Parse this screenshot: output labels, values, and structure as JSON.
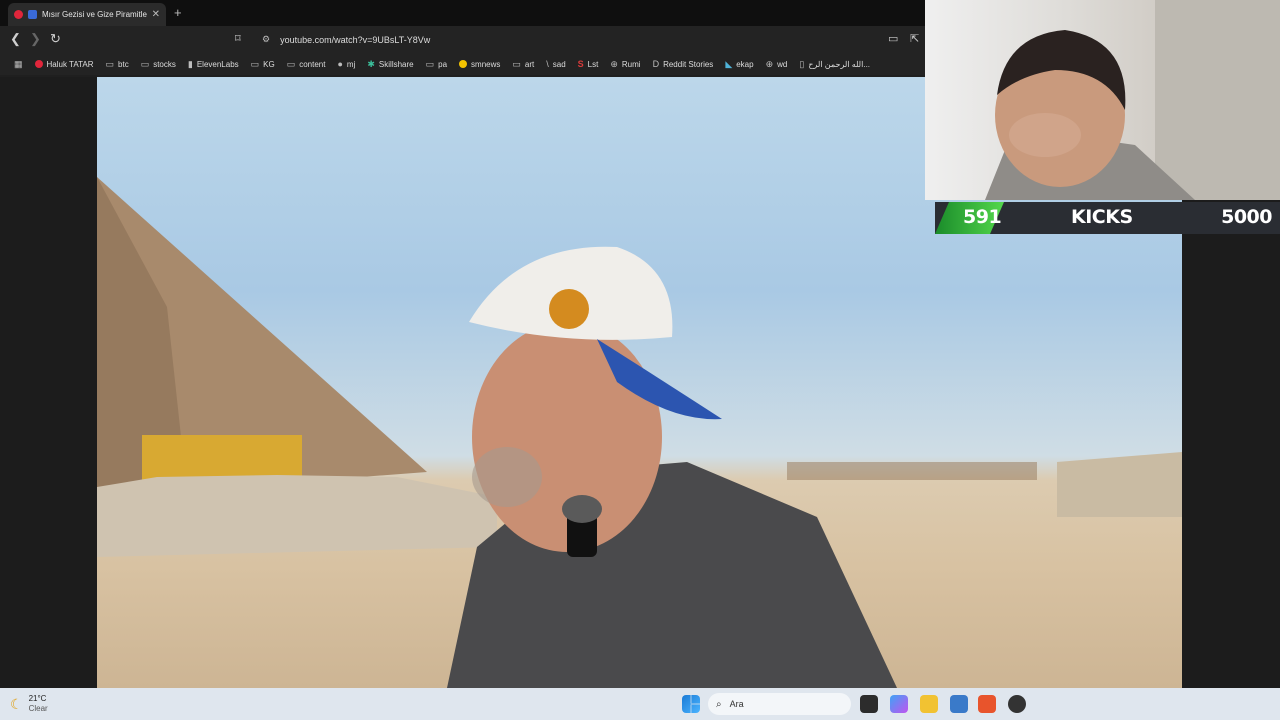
{
  "browser": {
    "tab": {
      "title": "Mısır Gezisi ve Gize Piramitleri"
    },
    "url": "youtube.com/watch?v=9UBsLT-Y8Vw",
    "bookmarks": [
      {
        "label": "Haluk TATAR",
        "icon": "youtube-icon",
        "color": "#e0263b"
      },
      {
        "label": "btc",
        "icon": "folder-icon"
      },
      {
        "label": "stocks",
        "icon": "folder-icon"
      },
      {
        "label": "ElevenLabs",
        "icon": "elevenlabs-icon"
      },
      {
        "label": "KG",
        "icon": "folder-icon"
      },
      {
        "label": "content",
        "icon": "folder-icon"
      },
      {
        "label": "mj",
        "icon": "github-icon"
      },
      {
        "label": "Skillshare",
        "icon": "skillshare-icon"
      },
      {
        "label": "pa",
        "icon": "folder-icon"
      },
      {
        "label": "smnews",
        "icon": "smiley-icon",
        "color": "#f2c200"
      },
      {
        "label": "art",
        "icon": "folder-icon"
      },
      {
        "label": "sad",
        "icon": "slash-icon"
      },
      {
        "label": "Lst",
        "icon": "s-icon",
        "color": "#d83a3a"
      },
      {
        "label": "Rumi",
        "icon": "globe-icon"
      },
      {
        "label": "Reddit Stories",
        "icon": "d-icon"
      },
      {
        "label": "ekap",
        "icon": "bird-icon"
      },
      {
        "label": "wd",
        "icon": "globe-icon"
      },
      {
        "label": "الله الرحمن الرح...",
        "icon": "book-icon"
      }
    ]
  },
  "stream": {
    "goal_current": "591",
    "goal_label": "KICKS",
    "goal_target": "5000",
    "goal_fraction": 0.118
  },
  "taskbar": {
    "weather_temp": "21°C",
    "weather_desc": "Clear",
    "search_placeholder": "Ara"
  },
  "colors": {
    "goal_fill": "#54d84c",
    "taskbar_bg": "#dfe6ee",
    "browser_bg": "#232323"
  }
}
